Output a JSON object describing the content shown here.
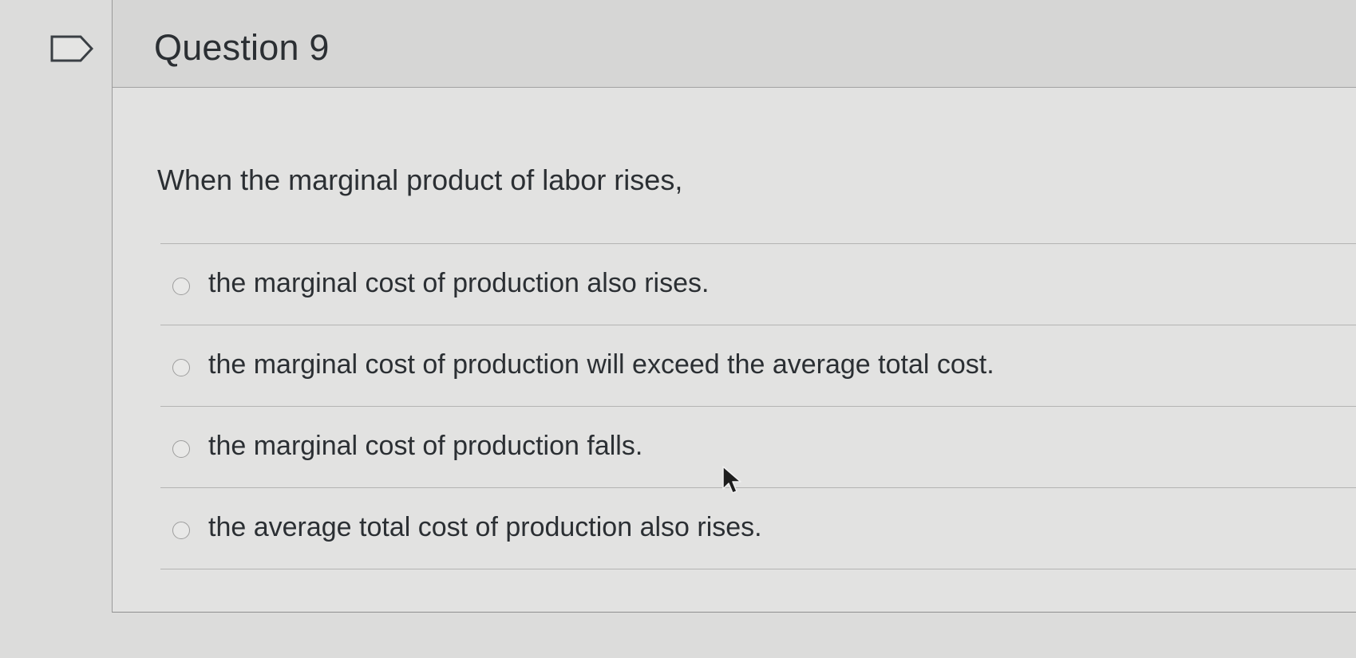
{
  "question": {
    "title": "Question 9",
    "text": "When the marginal product of labor rises,",
    "answers": [
      {
        "label": "the marginal cost of production also rises."
      },
      {
        "label": "the marginal cost of production will exceed the average total cost."
      },
      {
        "label": "the marginal cost of production falls."
      },
      {
        "label": "the average total cost of production also rises."
      }
    ]
  },
  "icons": {
    "flag": "flag-icon",
    "cursor": "mouse-pointer-icon"
  }
}
